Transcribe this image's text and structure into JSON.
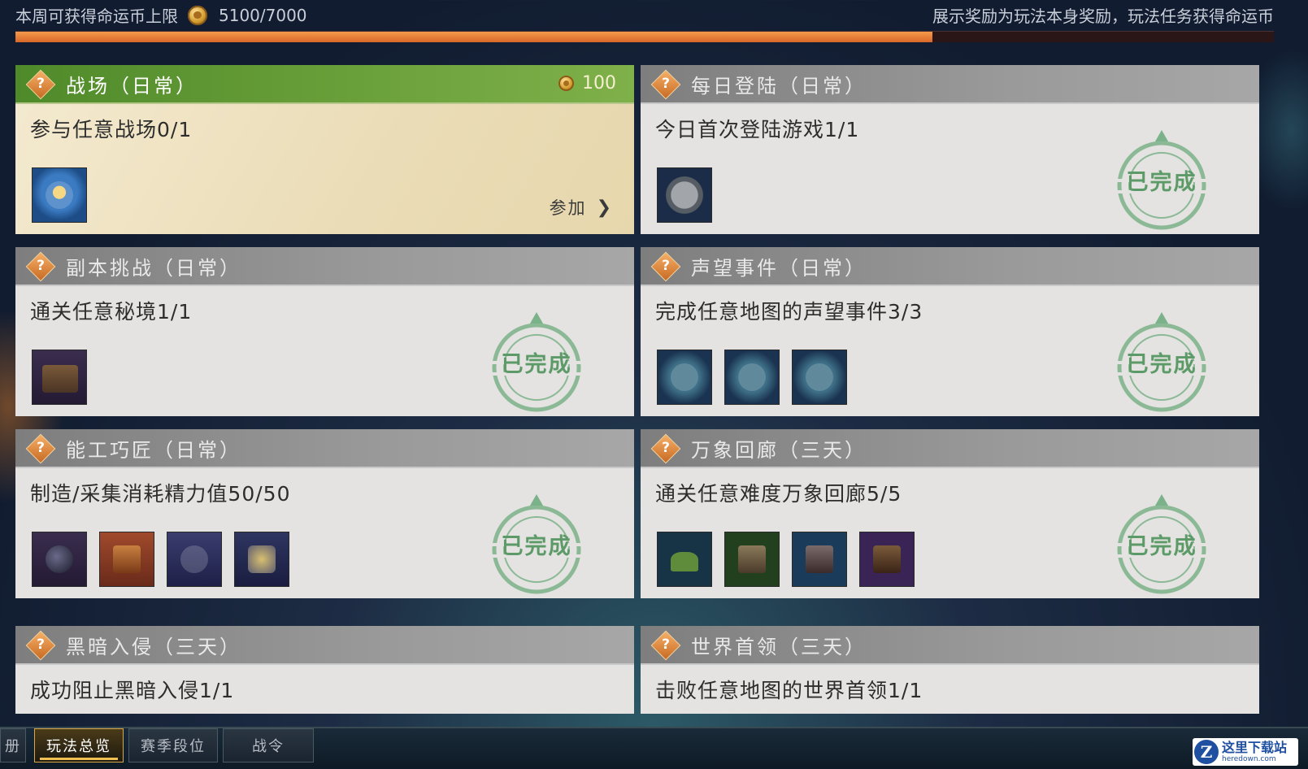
{
  "header": {
    "weekly_limit_label": "本周可获得命运币上限",
    "weekly_limit_value": "5100/7000",
    "progress_fraction": 0.7286,
    "note": "展示奖励为玩法本身奖励，玩法任务获得命运币"
  },
  "cards": [
    {
      "title": "战场（日常）",
      "reward": "100",
      "task": "参与任意战场0/1",
      "action": "参加",
      "completed": false
    },
    {
      "title": "每日登陆（日常）",
      "task": "今日首次登陆游戏1/1",
      "completed_label": "已完成"
    },
    {
      "title": "副本挑战（日常）",
      "task": "通关任意秘境1/1",
      "completed_label": "已完成"
    },
    {
      "title": "声望事件（日常）",
      "task": "完成任意地图的声望事件3/3",
      "completed_label": "已完成"
    },
    {
      "title": "能工巧匠（日常）",
      "task": "制造/采集消耗精力值50/50",
      "completed_label": "已完成"
    },
    {
      "title": "万象回廊（三天）",
      "task": "通关任意难度万象回廊5/5",
      "completed_label": "已完成"
    },
    {
      "title": "黑暗入侵（三天）",
      "task": "成功阻止黑暗入侵1/1"
    },
    {
      "title": "世界首领（三天）",
      "task": "击败任意地图的世界首领1/1"
    }
  ],
  "tabs": [
    "册",
    "玩法总览",
    "赛季段位",
    "战令"
  ],
  "active_tab": "玩法总览",
  "watermark": {
    "logo": "Z",
    "cn": "这里下载站",
    "en": "heredown.com"
  },
  "colors": {
    "progress": "#e2762e",
    "active_header": "#5e962f",
    "completed_stamp": "#5c9a68"
  }
}
